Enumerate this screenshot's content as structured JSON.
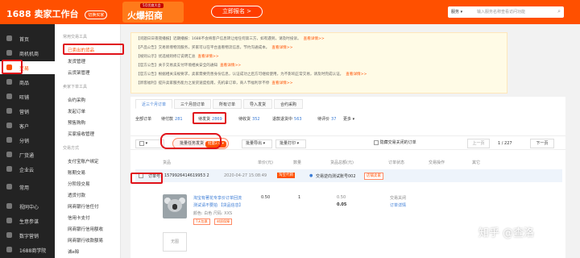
{
  "header": {
    "logo": "1688 卖家工作台",
    "logo_sub": "切换买家",
    "promo_small": "5月优商大会",
    "promo_big": "火爆招商",
    "signup": "立即报名 >",
    "search_select": "服务 ▾",
    "search_placeholder": "输入服务名称查看访问功能"
  },
  "sidebar": {
    "items": [
      {
        "label": "首页"
      },
      {
        "label": "商机机商"
      },
      {
        "label": "交易"
      },
      {
        "label": "商品"
      },
      {
        "label": "旺铺"
      },
      {
        "label": "营销"
      },
      {
        "label": "客户"
      },
      {
        "label": "分销"
      },
      {
        "label": "厂货通"
      },
      {
        "label": "企业云"
      },
      {
        "label": "常用"
      },
      {
        "label": "视同中心"
      },
      {
        "label": "生意参谋"
      },
      {
        "label": "数字营销"
      },
      {
        "label": "1688商学院"
      }
    ]
  },
  "submenu": {
    "g1": "常用交易工具",
    "i1": "已卖出的货品",
    "i2": "发货管理",
    "i3": "云货架管理",
    "g2": "卖家下单工具",
    "i4": "合约采购",
    "i5": "发起订单",
    "i6": "预售购购",
    "i7": "买家接收管理",
    "g3": "交易方式",
    "i8": "支付宝账户绑定",
    "i9": "账期交易",
    "i10": "分阶段交易",
    "i11": "透货付款",
    "i12": "网商银行信任付",
    "i13": "信用卡支付",
    "i14": "网商银行信用额收",
    "i15": "网商银行收款额易",
    "i16": "诚e赊"
  },
  "notices": [
    {
      "text": "【问题日日夜夜播报】近期播报：1688不会将客户信息转让给任何第三方，如有遇到，请及时投诉。",
      "link": "查看详情>>"
    },
    {
      "text": "【产品公告】交易新增物流服务，买家可以在平台查看物流信息，节约沟通成本。",
      "link": "查看详情>>"
    },
    {
      "text": "【规则公示】优选规则修订说明汇总",
      "link": "查看详情>>"
    },
    {
      "text": "【官方公告】关于交易卖支付环境相关安全的通知",
      "link": "查看详情>>"
    },
    {
      "text": "【官方公告】根据相关法规要求，卖家需要完善身份信息，认证成功之后方可继续使用，为不影响正常交易，请及时完成认证。",
      "link": "查看详情>>"
    },
    {
      "text": "【新客福利】提升卖家服务能力之发货速度指南，先机拿订单，商人节福利享不停",
      "link": "查看详情>>"
    }
  ],
  "tabs": [
    "近三个月订单",
    "三个月前订单",
    "所有订单",
    "导入发货",
    "合约采购"
  ],
  "status": [
    {
      "label": "全部订单",
      "count": ""
    },
    {
      "label": "待付款",
      "count": "281"
    },
    {
      "label": "待发货",
      "count": "2869"
    },
    {
      "label": "待收货",
      "count": "352"
    },
    {
      "label": "退款退货中",
      "count": "563"
    },
    {
      "label": "待评价",
      "count": "37"
    },
    {
      "label": "更多 ▾",
      "count": ""
    }
  ],
  "filters": {
    "batch_label": "批量任务发货",
    "batch_tag": "批量2.0 ▾",
    "export": "批量导出 ▾",
    "print": "批量打印 ▾",
    "hide_label": "隐藏交易关闭的订单",
    "prev": "上一页",
    "page_info": "1 / 227",
    "next": "下一页"
  },
  "columns": [
    "货品",
    "单价(元)",
    "数量",
    "货品总额(元)",
    "订单状态",
    "交易操作",
    "其它"
  ],
  "order": {
    "number_label": "订单号:",
    "number": "1579926414619953 2",
    "time": "2020-04-27 15:08:49",
    "seller_tag": "淘宝代销",
    "shop": "交易逆向测试账号002",
    "shop_tag": "店铺卖家",
    "product_title_1": "淘宝有著花专享价订单回流",
    "product_title_2": "测试请不要拍 【货品信息】",
    "spec": "颜色: 白色  尺码: XXS",
    "tag1": "7天包换",
    "tag2": "材质保障",
    "price": "0.50",
    "qty": "1",
    "total": "0.50",
    "total_big": "0.05",
    "status": "交易关闭",
    "detail": "订单详情",
    "second_thumb": "无图"
  },
  "watermark": "知乎 @查洛",
  "colors": {
    "brand": "#ff5000",
    "link": "#3a7bd5",
    "highlight": "#e0121a"
  }
}
